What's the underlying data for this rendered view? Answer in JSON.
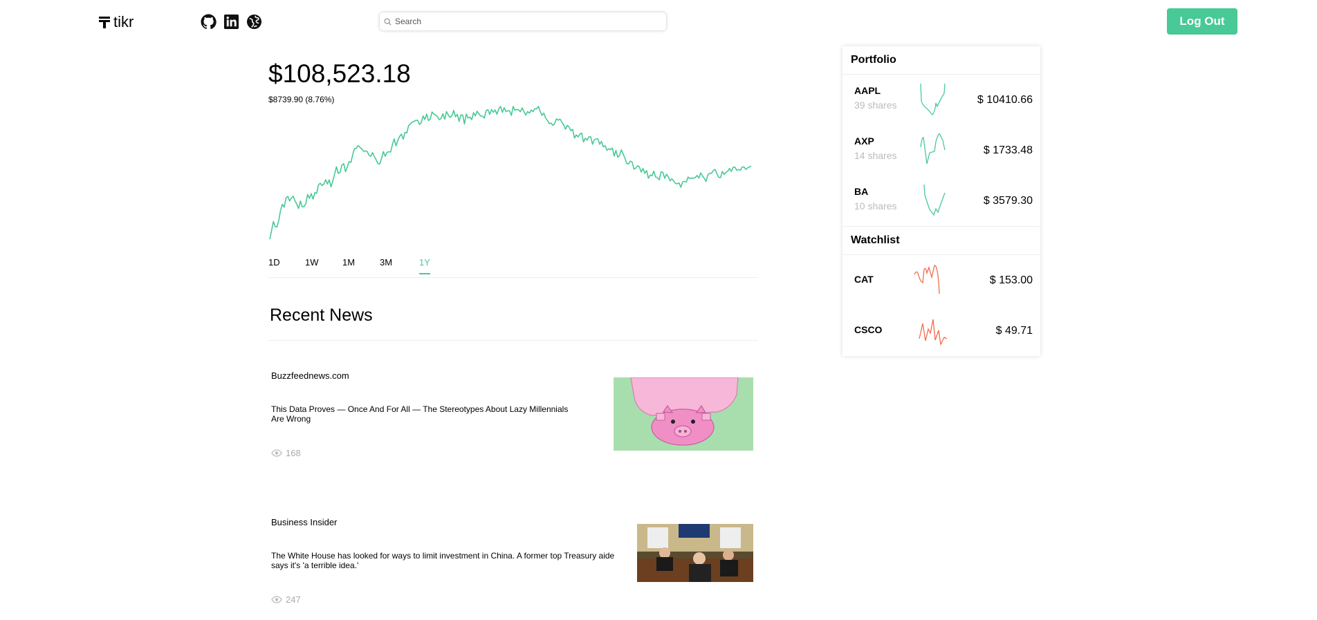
{
  "header": {
    "logo_text": "tikr",
    "search_placeholder": "Search",
    "logout_label": "Log Out",
    "social_icons": [
      "github-icon",
      "linkedin-icon",
      "globe-icon"
    ]
  },
  "account": {
    "balance": "$108,523.18",
    "change": "$8739.90 (8.76%)"
  },
  "chart_data": {
    "type": "line",
    "title": "",
    "xlabel": "",
    "ylabel": "",
    "color": "#48c995",
    "series": [
      {
        "values": [
          62.5,
          67.9,
          73.6,
          70.4,
          70.1,
          74.3,
          80.7,
          84.4,
          82.6,
          88.5,
          89.4,
          86.5,
          88.4,
          89.5,
          86.6,
          84.4,
          81.8,
          86.5,
          82.8,
          83.0,
          84.8,
          90.6,
          88.2,
          91.1,
          87.7,
          91.8,
          91.3,
          96.7,
          97.7,
          96.2,
          97.1,
          99.9,
          97.2,
          99.8,
          95.4,
          99.2,
          103.7,
          108.0,
          103.8,
          104.6,
          109.2,
          110.0,
          104.9,
          107.8,
          111.3,
          110.8,
          115.6,
          119.5,
          119.6,
          121.4,
          120.3,
          119.4,
          117.8,
          118.0,
          117.7,
          115.4,
          114.6,
          117.0,
          114.5,
          112.4,
          110.0,
          109.8,
          113.3,
          117.6,
          114.7,
          117.0,
          117.5,
          117.3,
          122.0,
          125.6,
          121.2,
          124.7,
          127.1,
          128.6,
          125.4,
          129.8,
          129.3,
          133.9,
          135.1,
          136.1,
          136.5,
          137.3,
          137.2,
          134.7,
          135.8,
          140.0,
          137.8,
          141.2,
          137.1,
          138.1,
          142.5,
          141.2,
          140.6,
          139.6,
          137.7,
          138.3,
          141.4,
          138.0,
          142.8,
          140.6,
          139.1,
          140.1,
          143.5,
          139.5,
          141.1,
          136.6,
          140.6,
          140.6,
          135.0,
          141.2,
          138.7,
          139.3,
          137.7,
          142.1,
          140.1,
          143.0,
          141.3,
          139.9,
          139.9,
          138.7,
          143.3,
          144.0,
          141.0,
          144.1,
          142.3,
          143.8,
          141.1,
          144.4,
          146.0,
          142.2,
          145.2,
          142.7,
          143.3,
          143.3,
          140.4,
          146.0,
          143.5,
          144.1,
          143.9,
          142.7,
          145.1,
          142.6,
          140.6,
          142.8,
          141.8,
          143.8,
          142.7,
          144.7,
          144.5,
          146.0,
          142.8,
          140.4,
          141.8,
          138.7,
          137.2,
          135.2,
          135.5,
          134.1,
          135.3,
          138.2,
          137.4,
          138.0,
          136.1,
          134.4,
          131.7,
          134.1,
          133.1,
          130.7,
          131.6,
          126.1,
          128.1,
          126.8,
          128.6,
          129.2,
          123.6,
          126.0,
          124.8,
          126.9,
          126.9,
          122.2,
          125.0,
          125.6,
          125.6,
          122.2,
          124.0,
          120.6,
          121.3,
          118.4,
          119.4,
          118.8,
          119.8,
          114.8,
          118.4,
          114.0,
          115.3,
          118.7,
          116.1,
          113.4,
          110.0,
          109.8,
          111.6,
          110.9,
          106.5,
          107.2,
          108.7,
          108.0,
          104.7,
          107.0,
          103.9,
          105.7,
          100.8,
          102.8,
          102.4,
          105.3,
          101.6,
          101.2,
          99.8,
          104.9,
          104.5,
          100.8,
          103.4,
          101.8,
          99.2,
          100.5,
          99.1,
          97.6,
          97.3,
          97.9,
          95.1,
          98.5,
          98.9,
          98.4,
          101.6,
          100.6,
          101.0,
          100.8,
          101.3,
          102.6,
          100.9,
          104.2,
          102.3,
          100.7,
          98.8,
          103.1,
          103.9,
          104.0,
          105.7,
          106.4,
          103.5,
          101.4,
          101.2,
          105.1,
          103.2,
          104.6,
          105.2,
          107.0,
          105.1,
          107.7,
          107.8,
          105.8,
          106.3,
          105.9,
          107.8,
          108.0,
          106.4,
          107.4,
          107.9,
          108.5
        ]
      }
    ]
  },
  "ranges": {
    "options": [
      "1D",
      "1W",
      "1M",
      "3M",
      "1Y"
    ],
    "active": "1Y"
  },
  "news": {
    "title": "Recent News",
    "articles": [
      {
        "source": "Buzzfeednews.com",
        "headline": "This Data Proves — Once And For All — The Stereotypes About Lazy Millennials Are Wrong",
        "views": "168"
      },
      {
        "source": "Business Insider",
        "headline": "The White House has looked for ways to limit investment in China. A former top Treasury aide says it's 'a terrible idea.'",
        "views": "247"
      }
    ]
  },
  "portfolio": {
    "title": "Portfolio",
    "color": "#48c995",
    "items": [
      {
        "symbol": "AAPL",
        "shares": "39 shares",
        "price": "$ 10410.66"
      },
      {
        "symbol": "AXP",
        "shares": "14 shares",
        "price": "$ 1733.48"
      },
      {
        "symbol": "BA",
        "shares": "10 shares",
        "price": "$ 3579.30"
      }
    ]
  },
  "watchlist": {
    "title": "Watchlist",
    "color": "#f26c4f",
    "items": [
      {
        "symbol": "CAT",
        "price": "$ 153.00"
      },
      {
        "symbol": "CSCO",
        "price": "$ 49.71"
      }
    ]
  }
}
